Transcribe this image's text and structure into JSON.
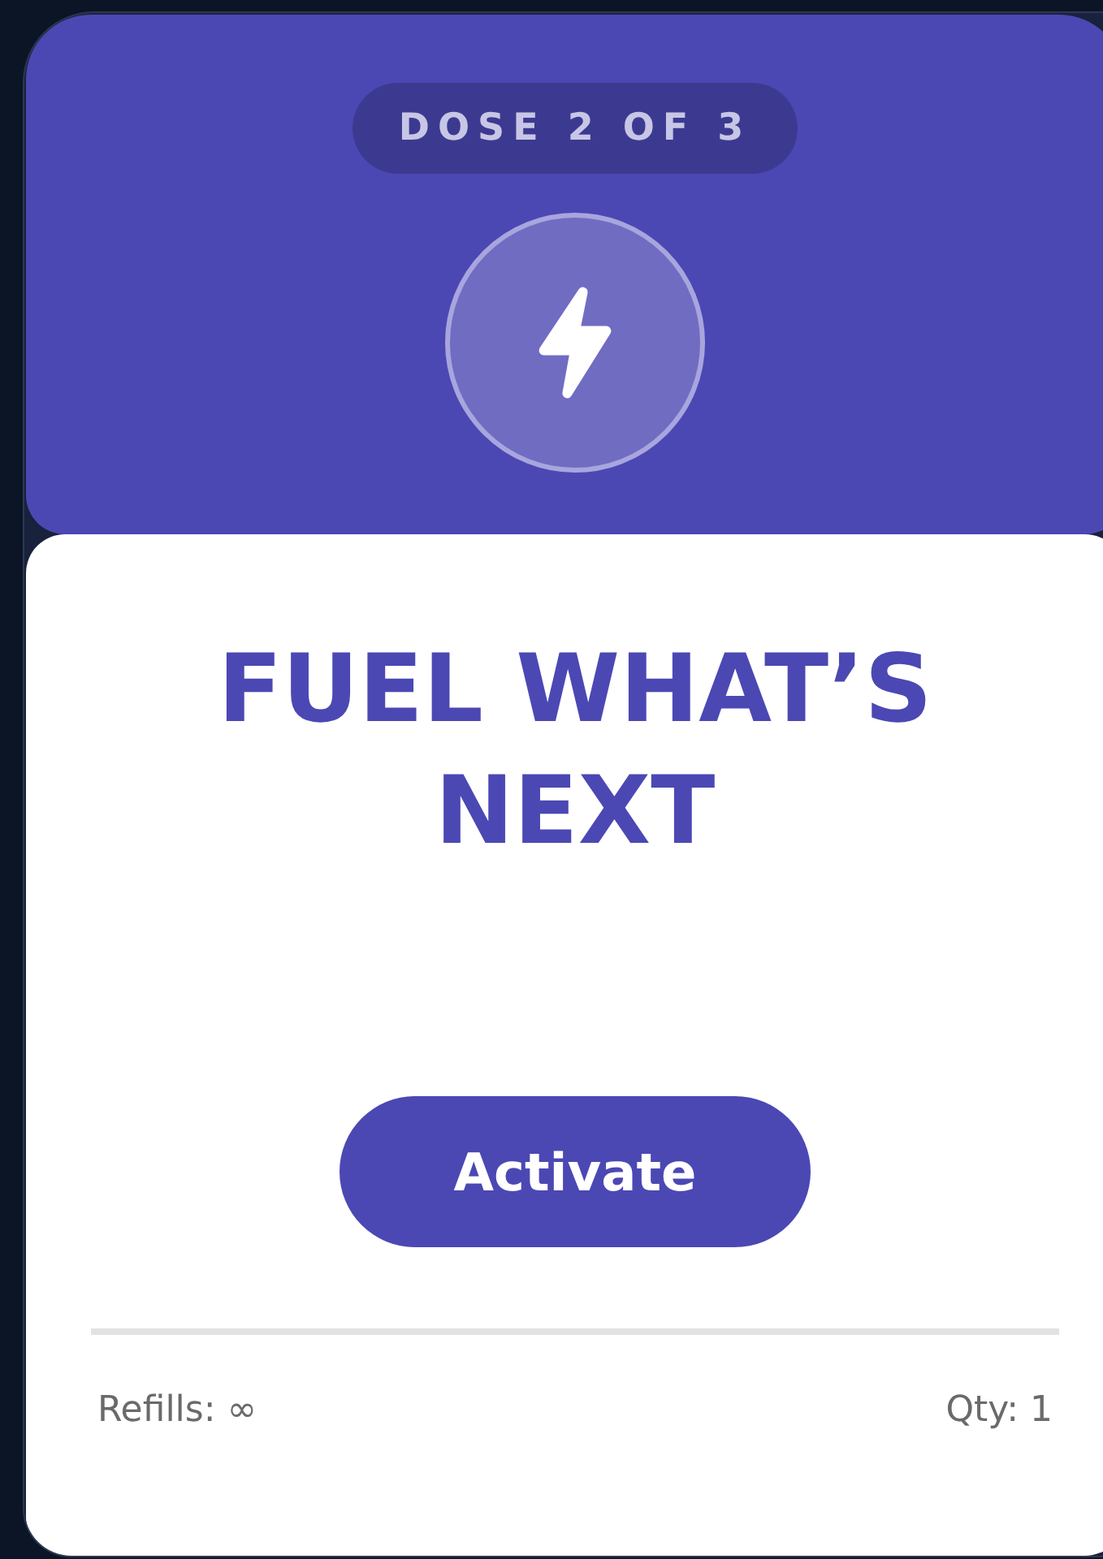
{
  "badge": "DOSE 2 OF 3",
  "title": "FUEL WHAT’S NEXT",
  "button": "Activate",
  "footer": {
    "refills": "Refills: ∞",
    "quantity": "Qty: 1"
  }
}
